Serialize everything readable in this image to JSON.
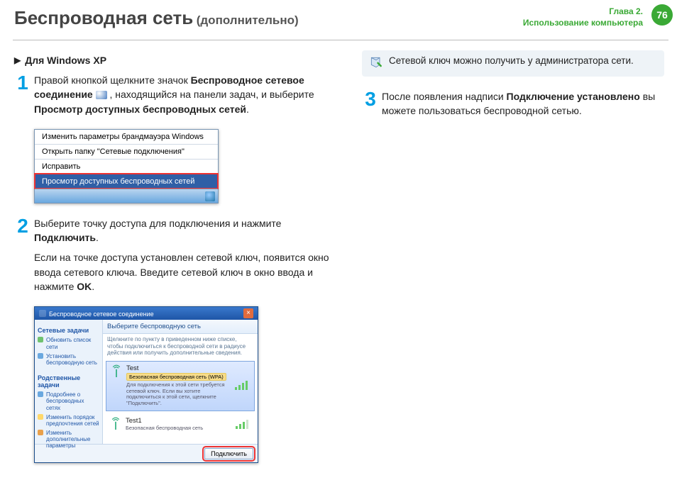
{
  "header": {
    "title": "Беспроводная сеть",
    "subtitle": "(дополнительно)",
    "chapter_line1": "Глава 2.",
    "chapter_line2": "Использование компьютера",
    "page_number": "76"
  },
  "left": {
    "heading": "Для Windows XP",
    "step1": {
      "num": "1",
      "p1a": "Правой кнопкой щелкните значок ",
      "bold1": "Беспроводное сетевое соединение",
      "p1b": " , находящийся на панели задач, и выберите ",
      "bold2": "Просмотр доступных беспроводных сетей",
      "p1c": "."
    },
    "ctx_menu": {
      "item1": "Изменить параметры брандмауэра Windows",
      "item2": "Открыть папку \"Сетевые подключения\"",
      "item3": "Исправить",
      "item4": "Просмотр доступных беспроводных сетей"
    },
    "step2": {
      "num": "2",
      "p1a": "Выберите точку доступа для подключения и нажмите ",
      "bold1": "Подключить",
      "p1c": ".",
      "p2a": "Если на точке доступа установлен сетевой ключ, появится окно ввода сетевого ключа. Введите сетевой ключ в окно ввода и нажмите ",
      "bold2": "OK",
      "p2c": "."
    },
    "win": {
      "title": "Беспроводное сетевое соединение",
      "side_head1": "Сетевые задачи",
      "side_item1": "Обновить список сети",
      "side_item2": "Установить беспроводную сеть",
      "side_head2": "Родственные задачи",
      "side_item3": "Подробнее о беспроводных сетях",
      "side_item4": "Изменить порядок предпочтения сетей",
      "side_item5": "Изменить дополнительные параметры",
      "main_head": "Выберите беспроводную сеть",
      "main_desc": "Щелкните по пункту в приведенном ниже списке, чтобы подключиться к беспроводной сети в радиусе действия или получить дополнительные сведения.",
      "ap1_name": "Test",
      "ap1_badge": "Безопасная беспроводная сеть (WPA)",
      "ap1_note": "Для подключения к этой сети требуется сетевой ключ. Если вы хотите подключиться к этой сети, щелкните \"Подключить\".",
      "ap2_name": "Test1",
      "ap2_note": "Безопасная беспроводная сеть",
      "connect_btn": "Подключить"
    }
  },
  "right": {
    "tip": "Сетевой ключ можно получить у администратора сети.",
    "step3": {
      "num": "3",
      "p1a": "После появления надписи ",
      "bold1": "Подключение установлено",
      "p1b": " вы можете пользоваться беспроводной сетью."
    }
  }
}
